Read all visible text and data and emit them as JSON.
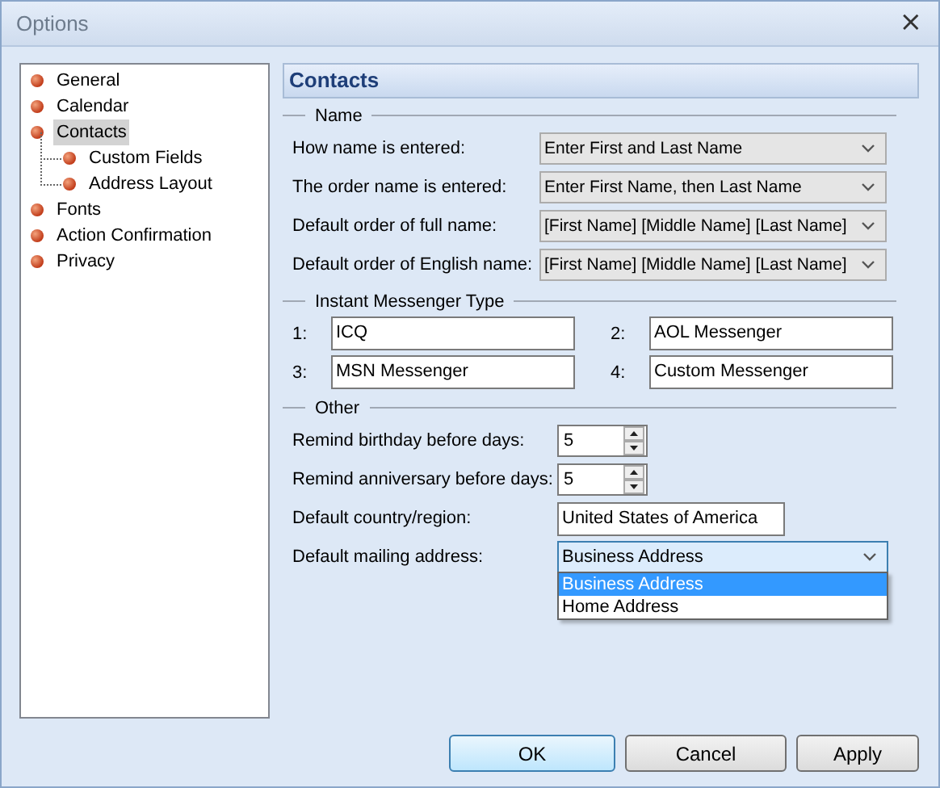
{
  "window": {
    "title": "Options",
    "close": "×"
  },
  "tree": [
    {
      "label": "General",
      "selected": false
    },
    {
      "label": "Calendar",
      "selected": false
    },
    {
      "label": "Contacts",
      "selected": true,
      "children": [
        {
          "label": "Custom Fields",
          "selected": false
        },
        {
          "label": "Address Layout",
          "selected": false
        }
      ]
    },
    {
      "label": "Fonts",
      "selected": false
    },
    {
      "label": "Action Confirmation",
      "selected": false
    },
    {
      "label": "Privacy",
      "selected": false
    }
  ],
  "panel": {
    "title": "Contacts",
    "name_group": {
      "title": "Name",
      "rows": [
        {
          "label": "How name is entered:",
          "value": "Enter First and Last Name"
        },
        {
          "label": "The order name is entered:",
          "value": "Enter First Name, then Last Name"
        },
        {
          "label": "Default order of full name:",
          "value": "[First Name] [Middle Name] [Last Name]"
        },
        {
          "label": "Default order of English name:",
          "value": "[First Name] [Middle Name] [Last Name]"
        }
      ]
    },
    "im_group": {
      "title": "Instant Messenger Type",
      "entries": [
        {
          "number": "1:",
          "value": "ICQ"
        },
        {
          "number": "2:",
          "value": "AOL Messenger"
        },
        {
          "number": "3:",
          "value": "MSN Messenger"
        },
        {
          "number": "4:",
          "value": "Custom Messenger"
        }
      ]
    },
    "other_group": {
      "title": "Other",
      "spinners": [
        {
          "label": "Remind birthday before days:",
          "value": "5"
        },
        {
          "label": "Remind anniversary before days:",
          "value": "5"
        }
      ],
      "country": {
        "label": "Default country/region:",
        "value": "United States of America"
      },
      "mailing": {
        "label": "Default mailing address:",
        "value": "Business Address",
        "expanded": true,
        "options": [
          {
            "label": "Business Address",
            "selected": true
          },
          {
            "label": "Home Address",
            "selected": false
          }
        ]
      }
    }
  },
  "buttons": [
    {
      "label": "OK",
      "default": true
    },
    {
      "label": "Cancel",
      "default": false
    },
    {
      "label": "Apply",
      "default": false
    }
  ]
}
